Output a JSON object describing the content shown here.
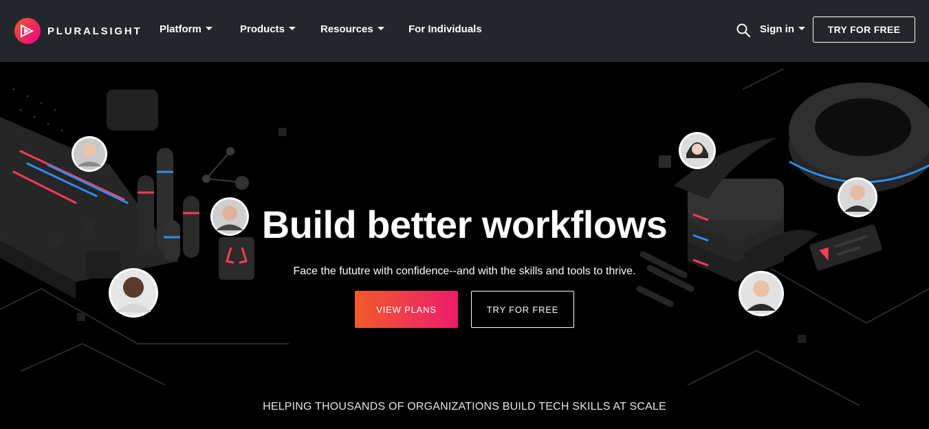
{
  "brand": {
    "name": "PLURALSIGHT",
    "colors": {
      "accent_start": "#f05a28",
      "accent_end": "#ec008c",
      "nav_bg": "#23262b"
    }
  },
  "nav": {
    "items": [
      {
        "label": "Platform",
        "has_dropdown": true
      },
      {
        "label": "Products",
        "has_dropdown": true
      },
      {
        "label": "Resources",
        "has_dropdown": true
      },
      {
        "label": "For Individuals",
        "has_dropdown": false
      }
    ],
    "search_icon": "search-icon",
    "signin_label": "Sign in",
    "cta_label": "TRY FOR FREE"
  },
  "hero": {
    "headline": "Build better workflows",
    "subheadline": "Face the fututre with confidence--and with the skills and tools to thrive.",
    "primary_button": "VIEW PLANS",
    "secondary_button": "TRY FOR FREE",
    "avatar_count": 6
  },
  "tagline": "HELPING THOUSANDS OF ORGANIZATIONS BUILD TECH SKILLS AT SCALE"
}
